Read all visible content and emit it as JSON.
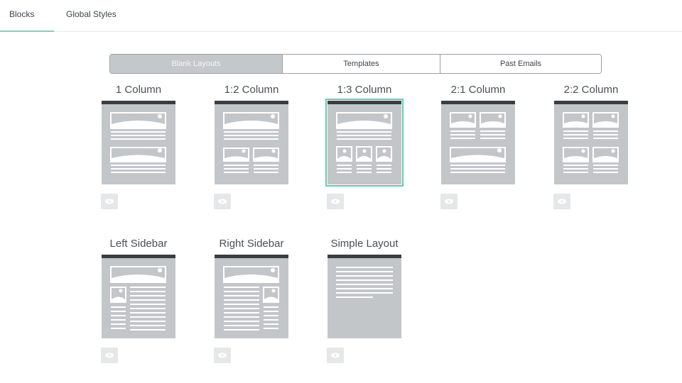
{
  "tabs": [
    {
      "label": "Blocks",
      "active": true
    },
    {
      "label": "Global Styles",
      "active": false
    }
  ],
  "segmented": [
    {
      "label": "Blank Layouts",
      "active": true
    },
    {
      "label": "Templates",
      "active": false
    },
    {
      "label": "Past Emails",
      "active": false
    }
  ],
  "layouts": [
    {
      "title": "1 Column",
      "selected": false
    },
    {
      "title": "1:2 Column",
      "selected": false
    },
    {
      "title": "1:3 Column",
      "selected": true
    },
    {
      "title": "2:1 Column",
      "selected": false
    },
    {
      "title": "2:2 Column",
      "selected": false
    },
    {
      "title": "Left Sidebar",
      "selected": false
    },
    {
      "title": "Right Sidebar",
      "selected": false
    },
    {
      "title": "Simple Layout",
      "selected": false
    }
  ],
  "icons": {
    "preview": "eye-icon"
  },
  "colors": {
    "accent": "#5fcfa6",
    "thumb": "#c3c6c9",
    "thumb_header": "#3a3e42",
    "active_segment": "#c5c8cb"
  }
}
